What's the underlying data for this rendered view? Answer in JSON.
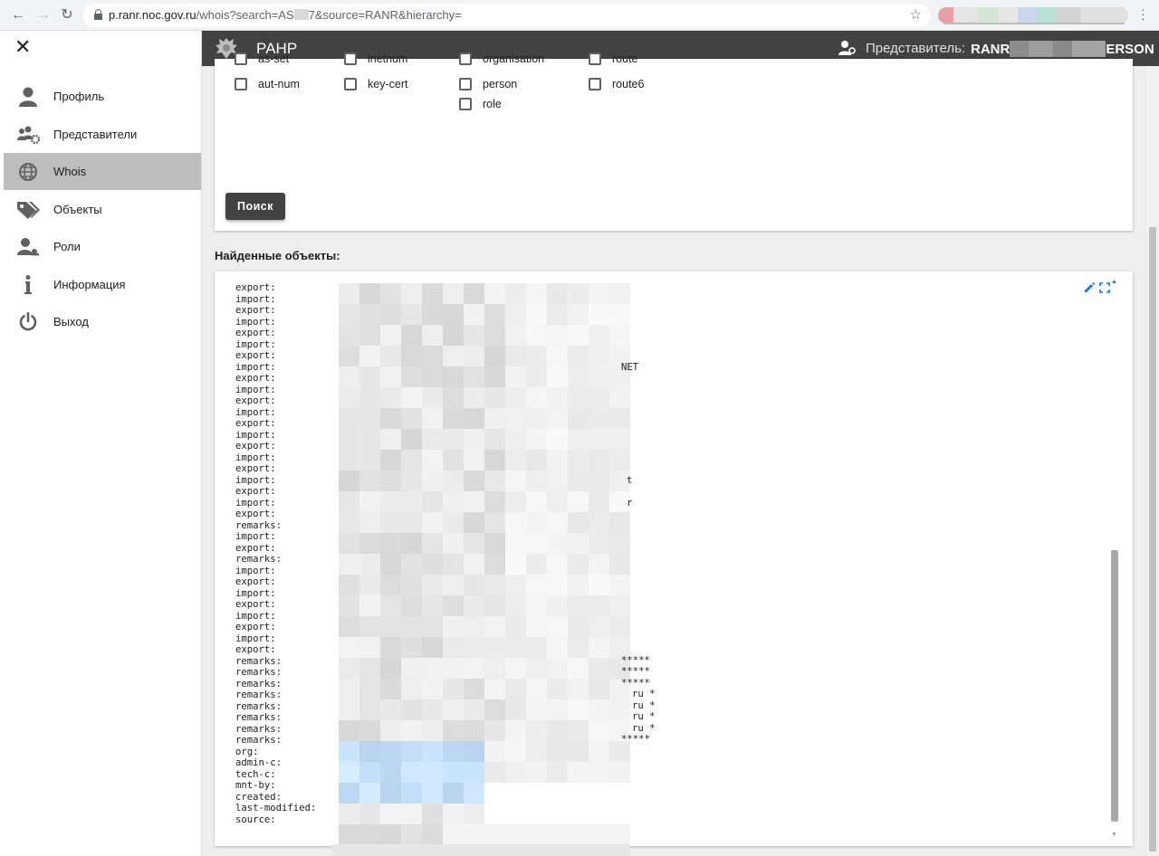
{
  "browser": {
    "url_prefix": "p.ranr.noc.gov.ru",
    "url_path_a": "/whois?search=AS",
    "url_path_b": "7&source=RANR&hierarchy="
  },
  "app": {
    "title": "РАНР",
    "rep_label": "Представитель:",
    "rep_value_start": "RANR",
    "rep_value_end": "ERSON"
  },
  "sidebar": {
    "items": [
      {
        "label": "Профиль",
        "icon": "person-icon"
      },
      {
        "label": "Представители",
        "icon": "people-gear-icon"
      },
      {
        "label": "Whois",
        "icon": "globe-icon"
      },
      {
        "label": "Объекты",
        "icon": "tags-icon"
      },
      {
        "label": "Роли",
        "icon": "person-key-icon"
      },
      {
        "label": "Информация",
        "icon": "info-icon"
      },
      {
        "label": "Выход",
        "icon": "power-icon"
      }
    ],
    "active": "Whois"
  },
  "filters": {
    "partial_row": [
      "as-set",
      "inetnum",
      "organisation",
      "route"
    ],
    "row1": [
      "aut-num",
      "key-cert",
      "person",
      "route6"
    ],
    "row2": [
      "role"
    ],
    "search_button": "Поиск"
  },
  "results": {
    "title": "Найденные объекты:",
    "lines": "export:\nimport:\nexport:\nimport:\nexport:\nimport:\nexport:\nimport:\nexport:\nimport:\nexport:\nimport:\nexport:\nimport:\nexport:\nimport:\nexport:\nimport:\nexport:\nimport:\nexport:\nremarks:\nimport:\nexport:\nremarks:\nimport:\nexport:\nimport:\nexport:\nimport:\nexport:\nimport:\nexport:\nremarks:\nremarks:\nremarks:\nremarks:\nremarks:\nremarks:\nremarks:\nremarks:\norg:\nadmin-c:\ntech-c:\nmnt-by:\ncreated:\nlast-modified:\nsource:",
    "trail_net": "NET",
    "trail_stars": "*****",
    "trail_ru": "ru *",
    "trail_t": "t",
    "trail_r": "r"
  },
  "colors": {
    "app_bar": "#424242",
    "sidebar_active": "#bdbdbd",
    "edit_icon": "#1976d2"
  }
}
